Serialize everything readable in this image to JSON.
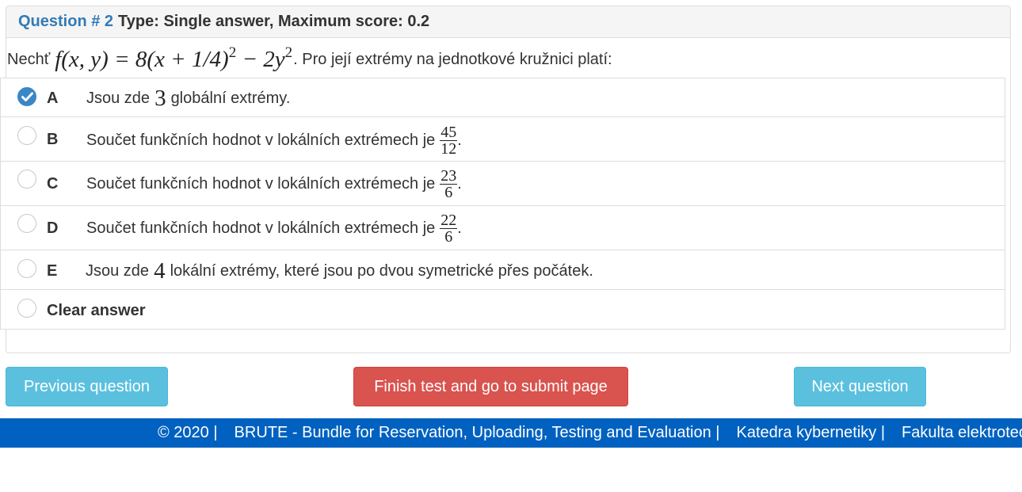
{
  "question": {
    "number_label": "Question # 2",
    "type_label": "Type: Single answer, Maximum score: 0.2",
    "text_prefix": "Nechť",
    "formula": {
      "lhs": "f(x, y) = 8(x + 1/4)",
      "exp1": "2",
      "mid": " − 2y",
      "exp2": "2"
    },
    "text_suffix": ". Pro její extrémy na jednotkové kružnici platí:"
  },
  "options": [
    {
      "letter": "A",
      "before": "Jsou zde",
      "math": "3",
      "after": "globální extrémy.",
      "selected": true
    },
    {
      "letter": "B",
      "before": "Součet funkčních hodnot v lokálních extrémech je",
      "num": "45",
      "den": "12",
      "after": ".",
      "selected": false
    },
    {
      "letter": "C",
      "before": "Součet funkčních hodnot v lokálních extrémech je",
      "num": "23",
      "den": "6",
      "after": ".",
      "selected": false
    },
    {
      "letter": "D",
      "before": "Součet funkčních hodnot v lokálních extrémech je",
      "num": "22",
      "den": "6",
      "after": ".",
      "selected": false
    },
    {
      "letter": "E",
      "before": "Jsou zde",
      "math": "4",
      "after": "lokální extrémy, které jsou po dvou symetrické přes počátek.",
      "selected": false
    }
  ],
  "clear_answer": "Clear answer",
  "buttons": {
    "previous": "Previous question",
    "finish": "Finish test and go to submit page",
    "next": "Next question"
  },
  "footer": {
    "copyright": "© 2020 |",
    "brute": "BRUTE - Bundle for Reservation, Uploading, Testing and Evaluation |",
    "katedra": "Katedra kybernetiky |",
    "fakulta": "Fakulta elektrotechnická"
  },
  "colors": {
    "link_blue": "#337ab7",
    "info": "#5bc0de",
    "danger": "#d9534f",
    "footer": "#0061c0",
    "checked_radio": "#3a87c8"
  }
}
